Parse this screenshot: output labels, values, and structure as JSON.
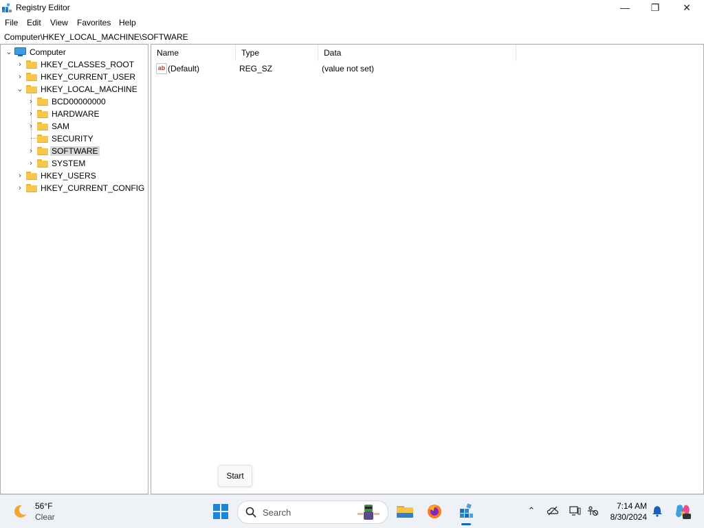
{
  "window": {
    "title": "Registry Editor",
    "controls": {
      "minimize": "—",
      "maximize": "❐",
      "close": "✕"
    }
  },
  "menu": [
    "File",
    "Edit",
    "View",
    "Favorites",
    "Help"
  ],
  "address": "Computer\\HKEY_LOCAL_MACHINE\\SOFTWARE",
  "tree": {
    "root": "Computer",
    "nodes": [
      {
        "label": "HKEY_CLASSES_ROOT",
        "expanded": false
      },
      {
        "label": "HKEY_CURRENT_USER",
        "expanded": false
      },
      {
        "label": "HKEY_LOCAL_MACHINE",
        "expanded": true
      },
      {
        "label": "BCD00000000",
        "expanded": false
      },
      {
        "label": "HARDWARE",
        "expanded": false
      },
      {
        "label": "SAM",
        "expanded": false
      },
      {
        "label": "SECURITY",
        "expanded": false
      },
      {
        "label": "SOFTWARE",
        "expanded": false,
        "selected": true
      },
      {
        "label": "SYSTEM",
        "expanded": false
      },
      {
        "label": "HKEY_USERS",
        "expanded": false
      },
      {
        "label": "HKEY_CURRENT_CONFIG",
        "expanded": false
      }
    ]
  },
  "list": {
    "columns": [
      "Name",
      "Type",
      "Data"
    ],
    "rows": [
      {
        "icon": "ab",
        "name": "(Default)",
        "type": "REG_SZ",
        "data": "(value not set)"
      }
    ]
  },
  "tooltip": "Start",
  "taskbar": {
    "weather": {
      "temp": "56°F",
      "condition": "Clear",
      "icon": "moon-icon"
    },
    "search_label": "Search",
    "apps": [
      "start-icon",
      "file-explorer-icon",
      "firefox-icon",
      "registry-editor-icon"
    ],
    "tray": [
      "chevron-up-icon",
      "onedrive-icon",
      "network-icon",
      "accessibility-icon"
    ],
    "clock": {
      "time": "7:14 AM",
      "date": "8/30/2024"
    },
    "colors": {
      "accent": "#0a66c2",
      "folder": "#f5c84c"
    }
  }
}
